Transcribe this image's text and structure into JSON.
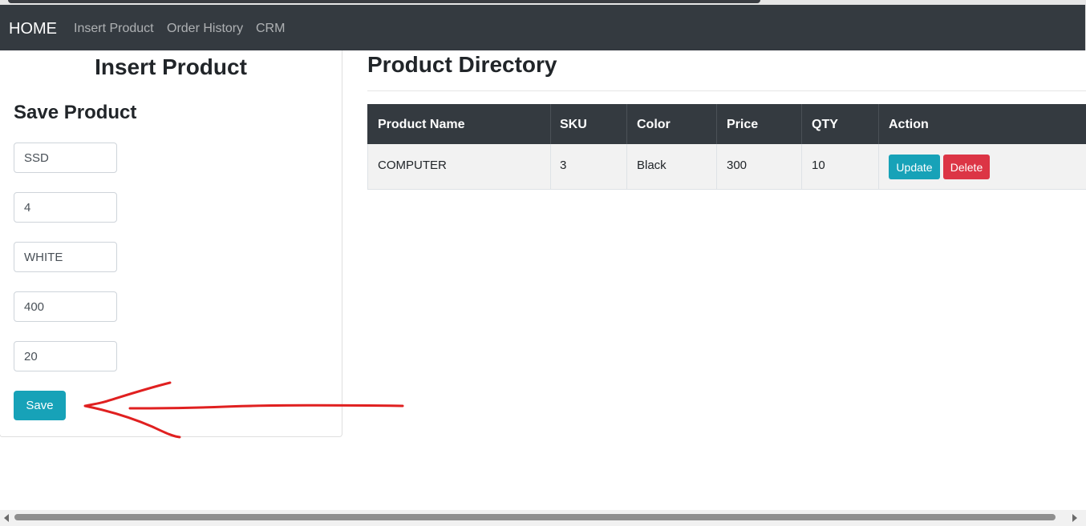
{
  "navbar": {
    "brand": "HOME",
    "links": [
      "Insert Product",
      "Order History",
      "CRM"
    ]
  },
  "insert_card": {
    "title": "Insert Product",
    "subtitle": "Save Product",
    "fields": [
      "SSD",
      "4",
      "WHITE",
      "400",
      "20"
    ],
    "save_label": "Save"
  },
  "directory": {
    "title": "Product Directory",
    "columns": [
      "Product Name",
      "SKU",
      "Color",
      "Price",
      "QTY",
      "Action"
    ],
    "rows": [
      {
        "name": "COMPUTER",
        "sku": "3",
        "color": "Black",
        "price": "300",
        "qty": "10",
        "update_label": "Update",
        "delete_label": "Delete"
      }
    ]
  },
  "colors": {
    "navbar_bg": "#343a40",
    "info_button": "#17a2b8",
    "danger_button": "#dc3545",
    "annotation_arrow": "#e02020"
  }
}
